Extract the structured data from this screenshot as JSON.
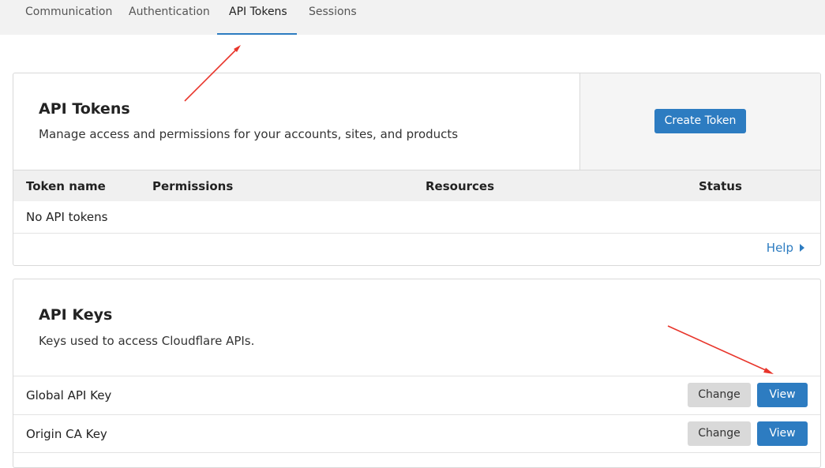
{
  "tabs": [
    {
      "label": "Communication",
      "active": false
    },
    {
      "label": "Authentication",
      "active": false
    },
    {
      "label": "API Tokens",
      "active": true
    },
    {
      "label": "Sessions",
      "active": false
    }
  ],
  "api_tokens": {
    "title": "API Tokens",
    "description": "Manage access and permissions for your accounts, sites, and products",
    "create_button": "Create Token",
    "columns": [
      "Token name",
      "Permissions",
      "Resources",
      "Status"
    ],
    "empty_text": "No API tokens",
    "help_link": "Help"
  },
  "api_keys": {
    "title": "API Keys",
    "description": "Keys used to access Cloudflare APIs.",
    "rows": [
      {
        "name": "Global API Key",
        "change_label": "Change",
        "view_label": "View"
      },
      {
        "name": "Origin CA Key",
        "change_label": "Change",
        "view_label": "View"
      }
    ]
  },
  "colors": {
    "accent": "#2d7cc1",
    "annotation_arrow": "#e8352b"
  }
}
